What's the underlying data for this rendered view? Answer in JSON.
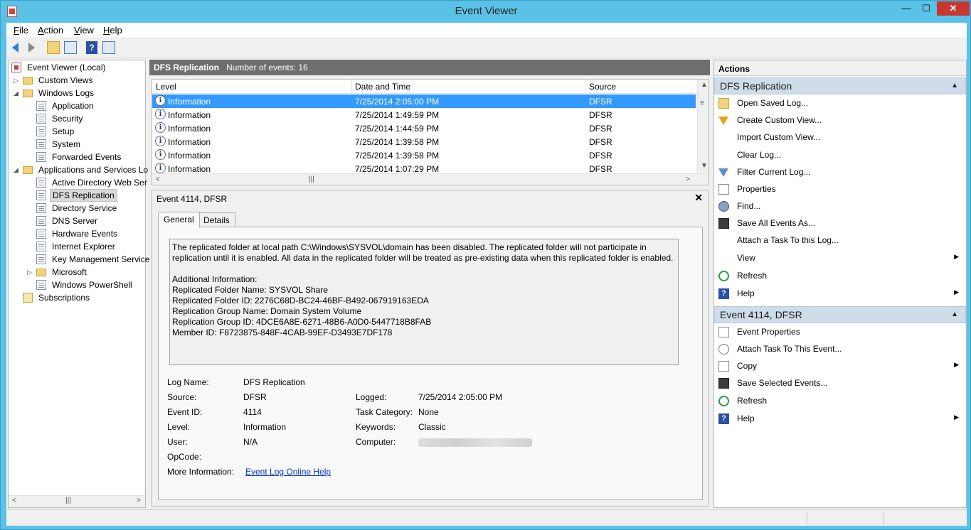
{
  "window": {
    "title": "Event Viewer",
    "min_glyph": "—",
    "max_glyph": "☐",
    "close_glyph": "✕"
  },
  "menubar": {
    "file": "F",
    "file_rest": "ile",
    "action": "A",
    "action_rest": "ction",
    "view": "V",
    "view_rest": "iew",
    "help": "H",
    "help_rest": "elp"
  },
  "tree": {
    "root": "Event Viewer (Local)",
    "custom_views": "Custom Views",
    "windows_logs": "Windows Logs",
    "application": "Application",
    "security": "Security",
    "setup": "Setup",
    "system": "System",
    "forwarded": "Forwarded Events",
    "apps_services": "Applications and Services Lo",
    "ad_web": "Active Directory Web Ser",
    "dfs": "DFS Replication",
    "directory": "Directory Service",
    "dns": "DNS Server",
    "hardware": "Hardware Events",
    "ie": "Internet Explorer",
    "kms": "Key Management Service",
    "microsoft": "Microsoft",
    "powershell": "Windows PowerShell",
    "subscriptions": "Subscriptions"
  },
  "list": {
    "title": "DFS Replication",
    "count_text": "Number of events: 16",
    "columns": {
      "level": "Level",
      "datetime": "Date and Time",
      "source": "Source"
    },
    "rows": [
      {
        "level": "Information",
        "datetime": "7/25/2014 2:05:00 PM",
        "source": "DFSR"
      },
      {
        "level": "Information",
        "datetime": "7/25/2014 1:49:59 PM",
        "source": "DFSR"
      },
      {
        "level": "Information",
        "datetime": "7/25/2014 1:44:59 PM",
        "source": "DFSR"
      },
      {
        "level": "Information",
        "datetime": "7/25/2014 1:39:58 PM",
        "source": "DFSR"
      },
      {
        "level": "Information",
        "datetime": "7/25/2014 1:39:58 PM",
        "source": "DFSR"
      },
      {
        "level": "Information",
        "datetime": "7/25/2014 1:07:29 PM",
        "source": "DFSR"
      }
    ]
  },
  "detail": {
    "title": "Event 4114, DFSR",
    "tab_general": "General",
    "tab_details": "Details",
    "message": "The replicated folder at local path C:\\Windows\\SYSVOL\\domain has been disabled. The replicated folder will not participate in\nreplication until it is enabled. All data in the replicated folder will be treated as pre-existing data when this replicated folder is enabled.\n\nAdditional Information:\nReplicated Folder Name: SYSVOL Share\nReplicated Folder ID: 2276C68D-BC24-46BF-B492-067919163EDA\nReplication Group Name: Domain System Volume\nReplication Group ID: 4DCE6A8E-6271-48B6-A0D0-5447718B8FAB\nMember ID: F8723875-848F-4CAB-99EF-D3493E7DF178",
    "log_name_label": "Log Name:",
    "log_name": "DFS Replication",
    "source_label": "Source:",
    "source": "DFSR",
    "logged_label": "Logged:",
    "logged": "7/25/2014 2:05:00 PM",
    "event_id_label": "Event ID:",
    "event_id": "4114",
    "task_label": "Task Category:",
    "task": "None",
    "level_label": "Level:",
    "level": "Information",
    "keywords_label": "Keywords:",
    "keywords": "Classic",
    "user_label": "User:",
    "user": "N/A",
    "computer_label": "Computer:",
    "opcode_label": "OpCode:",
    "more_info_label": "More Information:",
    "more_info_link": "Event Log Online Help"
  },
  "actions": {
    "header": "Actions",
    "section1": "DFS Replication",
    "items1": [
      "Open Saved Log...",
      "Create Custom View...",
      "Import Custom View...",
      "Clear Log...",
      "Filter Current Log...",
      "Properties",
      "Find...",
      "Save All Events As...",
      "Attach a Task To this Log...",
      "View",
      "Refresh",
      "Help"
    ],
    "section2": "Event 4114, DFSR",
    "items2": [
      "Event Properties",
      "Attach Task To This Event...",
      "Copy",
      "Save Selected Events...",
      "Refresh",
      "Help"
    ]
  }
}
